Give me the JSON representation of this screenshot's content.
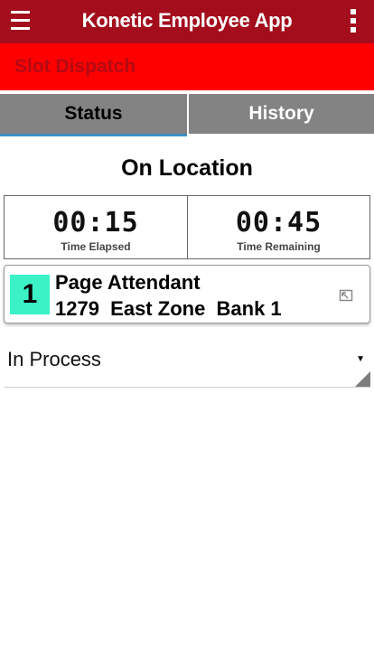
{
  "app_bar": {
    "title": "Konetic Employee App",
    "menu_icon": "hamburger-menu-icon",
    "more_icon": "more-vertical-icon",
    "background": "#a30d1c"
  },
  "dispatch": {
    "title": "Slot Dispatch",
    "background": "#fe0000"
  },
  "tabs": [
    {
      "label": "Status",
      "selected": true
    },
    {
      "label": "History",
      "selected": false
    }
  ],
  "status": {
    "heading": "On Location"
  },
  "timers": {
    "elapsed": {
      "value": "00:15",
      "label": "Time Elapsed"
    },
    "remaining": {
      "value": "00:45",
      "label": "Time Remaining"
    }
  },
  "task": {
    "priority": "1",
    "name": "Page Attendant",
    "location": "1279  East Zone  Bank 1",
    "badge_color": "#3bf2c6",
    "action_icon": "open-external-icon"
  },
  "status_select": {
    "value": "In Process"
  }
}
